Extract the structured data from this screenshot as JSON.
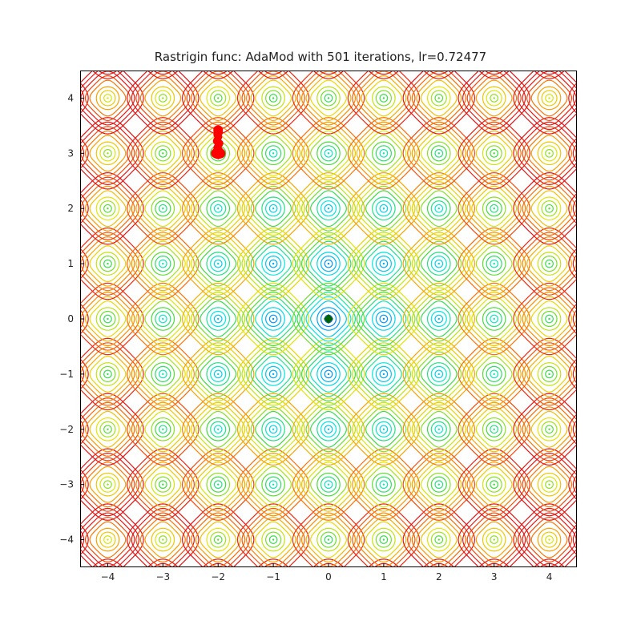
{
  "chart_data": {
    "type": "contour",
    "function": "Rastrigin",
    "optimizer": "AdaMod",
    "iterations": 501,
    "lr": 0.72477,
    "title": "Rastrigin func: AdaMod with 501 iterations, lr=0.72477",
    "xlabel": "",
    "ylabel": "",
    "xlim": [
      -4.5,
      4.5
    ],
    "ylim": [
      -4.5,
      4.5
    ],
    "xticks": [
      -4,
      -3,
      -2,
      -1,
      0,
      1,
      2,
      3,
      4
    ],
    "yticks": [
      -4,
      -3,
      -2,
      -1,
      0,
      1,
      2,
      3,
      4
    ],
    "grid_period": 1.0,
    "contour_levels": 20,
    "colormap": "rainbow",
    "global_minimum": {
      "x": 0,
      "y": 0,
      "marker": "diamond",
      "color": "#006400"
    },
    "trajectory": {
      "note": "Optimizer path (red) starts near (-2, 3.4) and settles near local minimum ~(-2, 3.0).",
      "color": "#ff0000",
      "points": [
        [
          -2.0,
          3.42
        ],
        [
          -1.98,
          3.38
        ],
        [
          -2.02,
          3.34
        ],
        [
          -1.99,
          3.3
        ],
        [
          -2.01,
          3.26
        ],
        [
          -2.03,
          3.22
        ],
        [
          -1.97,
          3.18
        ],
        [
          -2.0,
          3.14
        ],
        [
          -2.02,
          3.1
        ],
        [
          -1.98,
          3.06
        ],
        [
          -2.04,
          3.02
        ],
        [
          -2.06,
          3.0
        ],
        [
          -1.94,
          2.98
        ],
        [
          -2.0,
          3.0
        ],
        [
          -2.0,
          2.96
        ]
      ],
      "arrow_end": [
        -2.0,
        2.94
      ]
    }
  }
}
